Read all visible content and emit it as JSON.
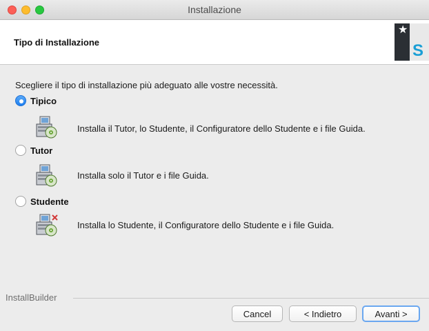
{
  "window": {
    "title": "Installazione"
  },
  "header": {
    "title": "Tipo di Installazione"
  },
  "intro": "Scegliere il tipo di installazione più adeguato alle vostre necessità.",
  "options": [
    {
      "label": "Tipico",
      "selected": true,
      "description": "Installa il Tutor, lo Studente, il Configuratore dello Studente e i file Guida."
    },
    {
      "label": "Tutor",
      "selected": false,
      "description": "Installa solo il Tutor e i file Guida."
    },
    {
      "label": "Studente",
      "selected": false,
      "description": "Installa lo Studente, il Configuratore dello Studente e i file Guida."
    }
  ],
  "footer": {
    "brand": "InstallBuilder",
    "cancel_label": "Cancel",
    "back_label": "< Indietro",
    "next_label": "Avanti >"
  },
  "colors": {
    "accent": "#1d7ef0",
    "content_bg": "#ececec",
    "logo_blue": "#1a9fd6"
  }
}
